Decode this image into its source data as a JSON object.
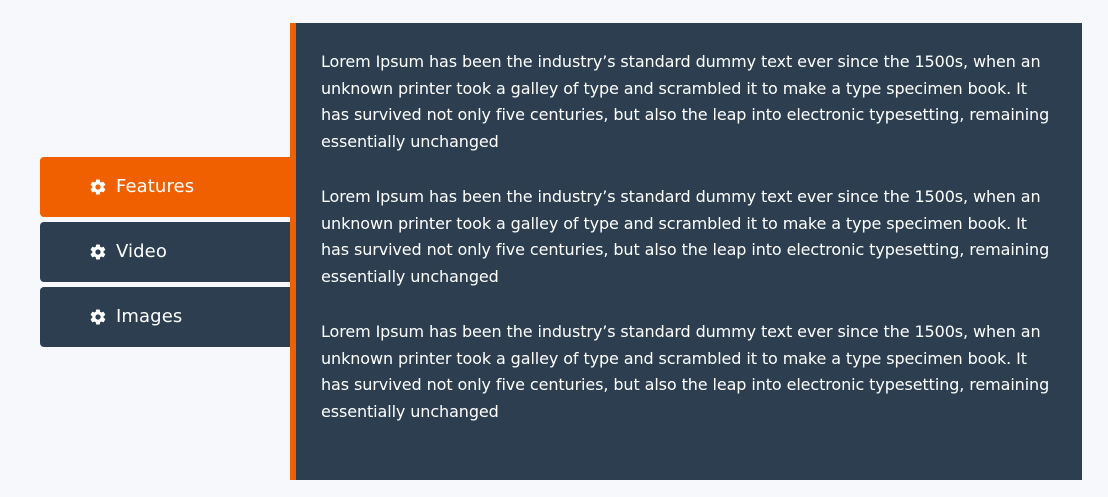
{
  "tabs": [
    {
      "label": "Features",
      "icon": "gear-icon",
      "active": true
    },
    {
      "label": "Video",
      "icon": "gear-icon",
      "active": false
    },
    {
      "label": "Images",
      "icon": "gear-icon",
      "active": false
    }
  ],
  "content": {
    "paragraphs": [
      "Lorem Ipsum has been the industry’s standard dummy text ever since the 1500s, when an unknown printer took a galley of type and scrambled it to make a type specimen book. It has survived not only five centuries, but also the leap into electronic typesetting, remaining essentially unchanged",
      "Lorem Ipsum has been the industry’s standard dummy text ever since the 1500s, when an unknown printer took a galley of type and scrambled it to make a type specimen book. It has survived not only five centuries, but also the leap into electronic typesetting, remaining essentially unchanged",
      "Lorem Ipsum has been the industry’s standard dummy text ever since the 1500s, when an unknown printer took a galley of type and scrambled it to make a type specimen book. It has survived not only five centuries, but also the leap into electronic typesetting, remaining essentially unchanged"
    ]
  },
  "colors": {
    "accent": "#f06000",
    "panel": "#2c3e50",
    "background": "#f6f8fb",
    "text": "#ffffff"
  }
}
